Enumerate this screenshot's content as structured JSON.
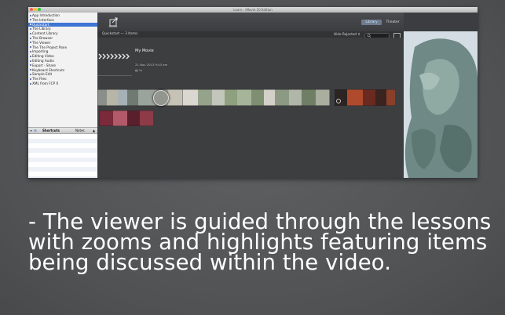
{
  "window": {
    "title": "Learn - iMovie 10 Edition",
    "traffic_colors": [
      "#ff5f57",
      "#febc2e",
      "#28c840"
    ]
  },
  "sidebar": {
    "lessons": [
      "App Introduction",
      "The Interface",
      "Quickstart",
      "The Library",
      "Content Library",
      "The Browser",
      "The Viewer",
      "The The Project Pane",
      "Importing",
      "Editing Video",
      "Editing Audio",
      "Export - Share",
      "Keyboard Shortcuts",
      "Sample Edit",
      "The Files",
      "XML from FCP X"
    ],
    "selected_index": 2,
    "tabs": {
      "shortcuts": "Shortcuts",
      "notes": "Notes"
    }
  },
  "toolbar": {
    "share_label": "Share",
    "library_tab": "Library",
    "theater_tab": "Theater"
  },
  "browser": {
    "breadcrumb": "Quickstart — 3 Items",
    "hide_rejected": "Hide Rejected ⇕",
    "event": {
      "title": "My Movie",
      "date": "21 Nov 2013 9:43 am",
      "clips_icon": "film-icon"
    }
  },
  "caption": "- The viewer is guided through the lessons\nwith zooms and highlights featuring items\nbeing discussed within the video.",
  "colors": {
    "selection": "#3f76d4",
    "library_tab": "#6e7c8c",
    "background": "#56585a"
  }
}
